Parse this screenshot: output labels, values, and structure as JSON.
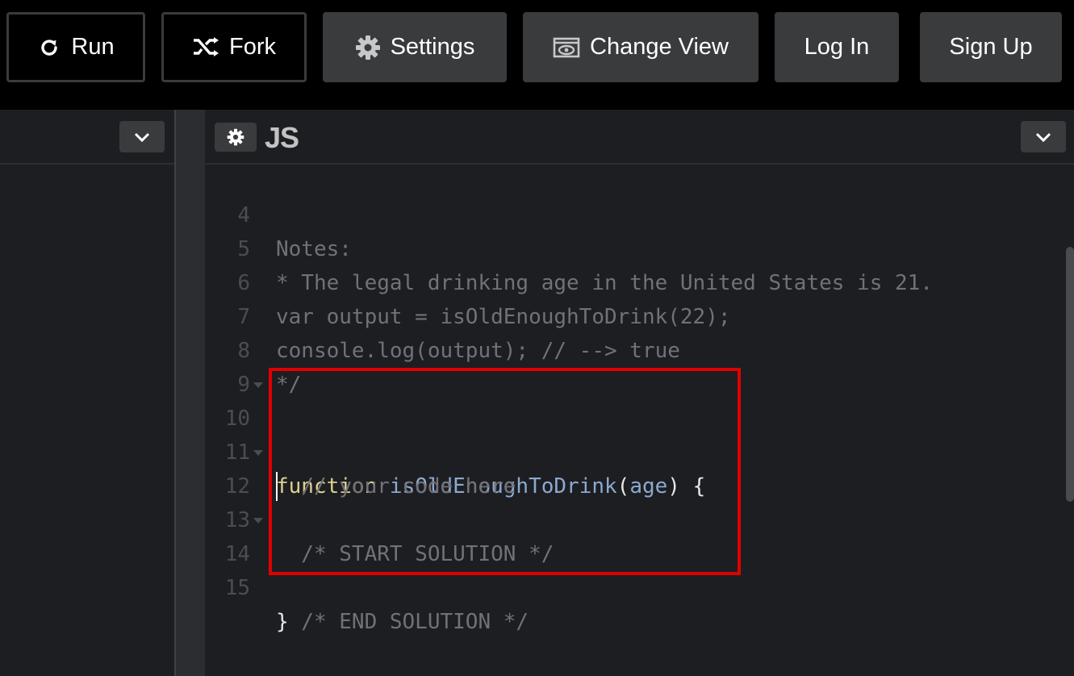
{
  "toolbar": {
    "run": "Run",
    "fork": "Fork",
    "settings": "Settings",
    "change_view": "Change View",
    "log_in": "Log In",
    "sign_up": "Sign Up"
  },
  "editor": {
    "language": "JS",
    "lines": [
      {
        "num": "4",
        "text": "Notes:"
      },
      {
        "num": "5",
        "text": "* The legal drinking age in the United States is 21."
      },
      {
        "num": "6",
        "text": "var output = isOldEnoughToDrink(22);"
      },
      {
        "num": "7",
        "text": "console.log(output); // --> true"
      },
      {
        "num": "8",
        "text": "*/"
      },
      {
        "num": "9",
        "text": ""
      },
      {
        "num": "10",
        "keyword": "function",
        "fn_name": "isOldEnoughToDrink",
        "param": "age",
        "tail": " {"
      },
      {
        "num": "11",
        "text": "  // your code here"
      },
      {
        "num": "12",
        "text": "  /* START SOLUTION */"
      },
      {
        "num": "13",
        "text": ""
      },
      {
        "num": "14",
        "text": "  /* END SOLUTION */"
      },
      {
        "num": "15",
        "text": "}"
      }
    ]
  },
  "colors": {
    "highlight_border": "#e10000",
    "keyword": "#dcd08e",
    "function_name": "#8ba9cf"
  }
}
